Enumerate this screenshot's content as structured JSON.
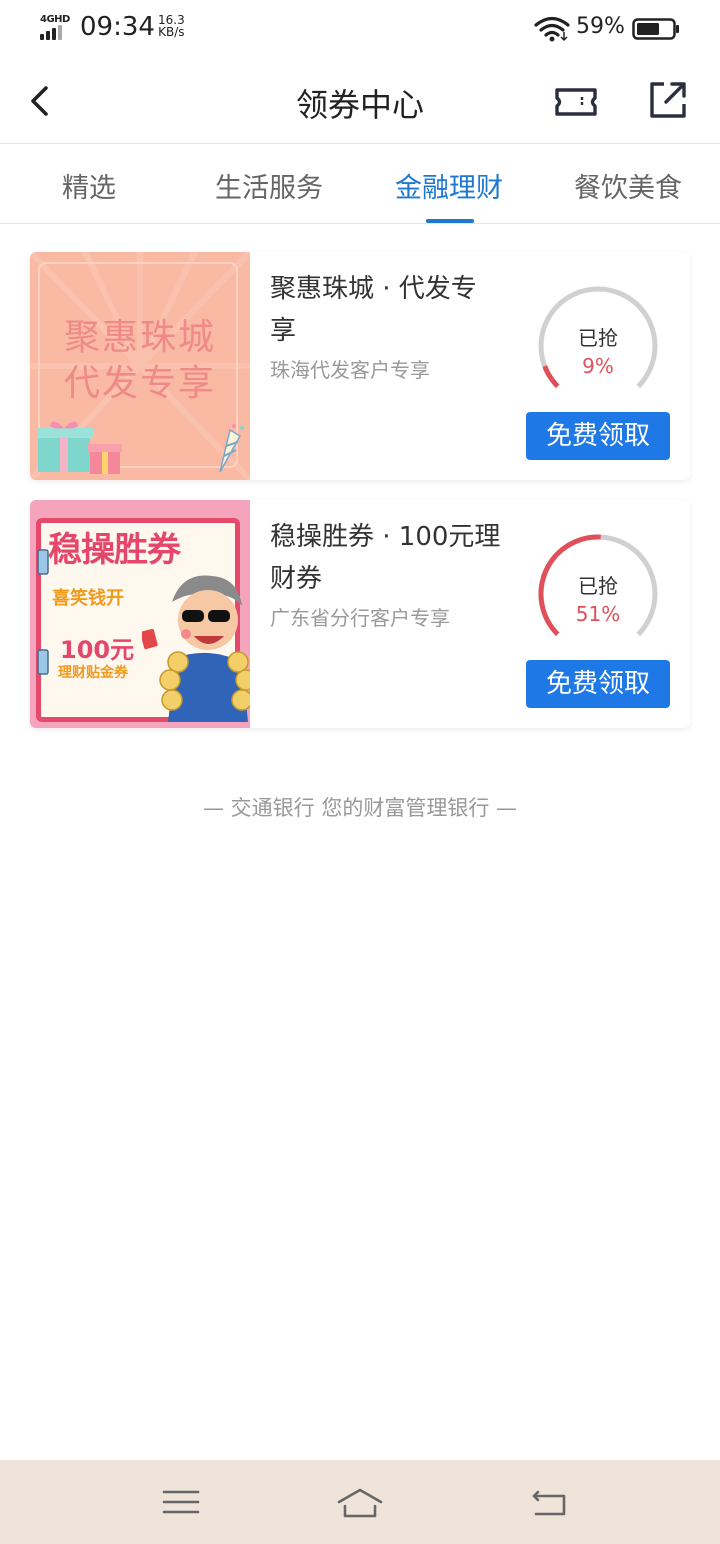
{
  "status_bar": {
    "network": "4GHD",
    "time": "09:34",
    "speed_value": "16.3",
    "speed_unit": "KB/s",
    "battery": "59%"
  },
  "header": {
    "title": "领券中心",
    "icons": [
      "back-icon",
      "ticket-icon",
      "share-icon"
    ]
  },
  "tabs": [
    {
      "label": "精选",
      "active": false
    },
    {
      "label": "生活服务",
      "active": false
    },
    {
      "label": "金融理财",
      "active": true
    },
    {
      "label": "餐饮美食",
      "active": false
    }
  ],
  "coupons": [
    {
      "title": "聚惠珠城 · 代发专享",
      "subtitle": "珠海代发客户专享",
      "image_text": [
        "聚惠珠城",
        "代发专享"
      ],
      "grabbed_label": "已抢",
      "grabbed_percent": "9%",
      "progress": 0.09,
      "button": "免费领取"
    },
    {
      "title": "稳操胜券 · 100元理财券",
      "subtitle": "广东省分行客户专享",
      "image_text": [
        "稳操胜券",
        "喜笑钱开",
        "100元",
        "理财贴金券"
      ],
      "grabbed_label": "已抢",
      "grabbed_percent": "51%",
      "progress": 0.51,
      "button": "免费领取"
    }
  ],
  "footer": {
    "slogan": "— 交通银行 您的财富管理银行 —"
  },
  "colors": {
    "accent": "#1e78e6",
    "progress": "#e0505a",
    "track": "#d0d0d0",
    "nav_bg": "#efe4d9"
  }
}
